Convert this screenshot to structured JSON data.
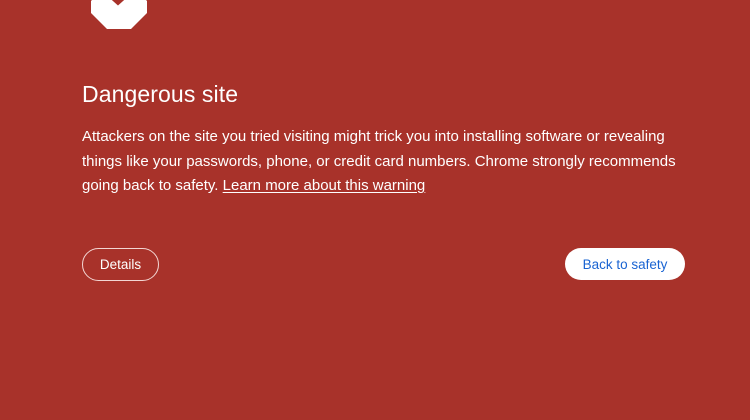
{
  "colors": {
    "background": "#a8322a",
    "text": "#ffffff",
    "primary_button_background": "#ffffff",
    "primary_button_text": "#1a64d2"
  },
  "icon": "danger-octagon-x-icon",
  "heading": "Dangerous site",
  "body": {
    "text": "Attackers on the site you tried visiting might trick you into installing software or revealing things like your passwords, phone, or credit card numbers. Chrome strongly recommends going back to safety.",
    "link": "Learn more about this warning"
  },
  "buttons": {
    "details": "Details",
    "back_to_safety": "Back to safety"
  }
}
